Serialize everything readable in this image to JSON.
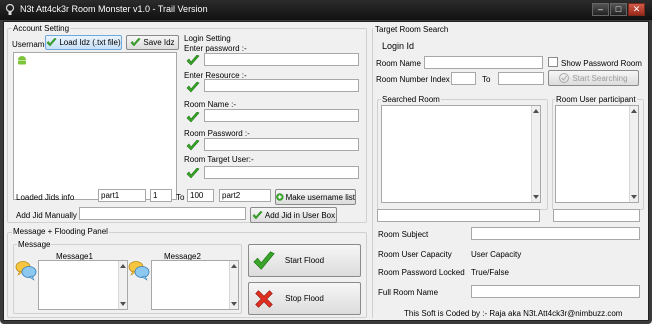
{
  "window": {
    "title": "N3t Att4ck3r Room Monster v1.0 - Trail Version"
  },
  "account": {
    "legend": "Account Setting",
    "username_label": "Username",
    "load_button": "Load Idz (.txt file)",
    "save_button": "Save Idz"
  },
  "login": {
    "legend": "Login Setting",
    "enter_password": "Enter password :-",
    "enter_resource": "Enter Resource :-",
    "room_name": "Room Name :-",
    "room_password": "Room Password :-",
    "room_target_user": "Room Target User:-"
  },
  "loaded": {
    "label": "Loaded Jids info",
    "part1": "part1",
    "from": "1",
    "to_label": "To",
    "to": "100",
    "part2": "part2",
    "make_button": "Make username list"
  },
  "add": {
    "label": "Add Jid Manually",
    "button": "Add Jid in User Box"
  },
  "flood": {
    "legend": "Message + Flooding Panel",
    "sub_legend": "Message",
    "message1": "Message1",
    "message2": "Message2",
    "start_button": "Start Flood",
    "stop_button": "Stop Flood"
  },
  "target": {
    "legend": "Target Room Search",
    "login_id": "Login Id",
    "room_name": "Room Name",
    "show_password": "Show Password Room",
    "room_number_index": "Room Number Index",
    "to_label": "To",
    "start_searching": "Start Searching",
    "searched_room": "Searched Room",
    "room_user_participant": "Room User participant",
    "room_subject": "Room Subject",
    "room_user_capacity": "Room User Capacity",
    "room_user_capacity_value": "User Capacity",
    "room_password_locked": "Room Password Locked",
    "room_password_locked_value": "True/False",
    "full_room_name": "Full Room Name",
    "footer": "This Soft is Coded by :- Raja aka N3t.Att4ck3r@nimbuzz.com"
  },
  "colors": {
    "check": "#3aa52a",
    "cross": "#e03020",
    "chrome": "#1a1a1a"
  }
}
